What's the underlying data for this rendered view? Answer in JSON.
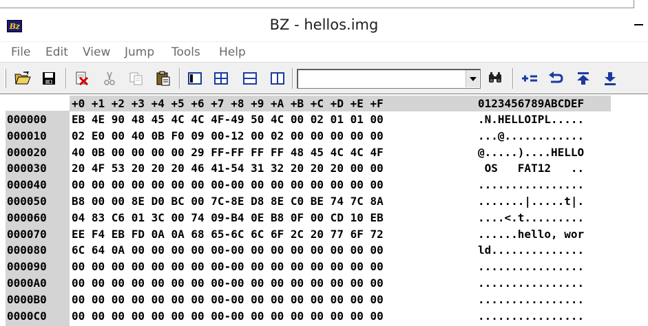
{
  "window": {
    "title": "BZ - hellos.img",
    "app_icon_text": "Bz"
  },
  "menu": [
    "File",
    "Edit",
    "View",
    "Jump",
    "Tools",
    "Help"
  ],
  "toolbar": {
    "search_value": "",
    "icons": [
      "open-icon",
      "save-icon",
      "delete-icon",
      "cut-icon",
      "copy-icon",
      "paste-icon",
      "view-mode-1-icon",
      "view-mode-2-icon",
      "split-horizontal-icon",
      "split-vertical-icon",
      "find-icon",
      "add-offset-icon",
      "back-icon",
      "jump-top-icon",
      "jump-bottom-icon"
    ]
  },
  "hexview": {
    "header_hex": "+0 +1 +2 +3 +4 +5 +6 +7 +8 +9 +A +B +C +D +E +F",
    "header_ascii": "0123456789ABCDEF",
    "rows": [
      {
        "addr": "000000",
        "hex": "EB 4E 90 48 45 4C 4C 4F-49 50 4C 00 02 01 01 00",
        "ascii": ".N.HELLOIPL....."
      },
      {
        "addr": "000010",
        "hex": "02 E0 00 40 0B F0 09 00-12 00 02 00 00 00 00 00",
        "ascii": "...@............"
      },
      {
        "addr": "000020",
        "hex": "40 0B 00 00 00 00 29 FF-FF FF FF 48 45 4C 4C 4F",
        "ascii": "@.....)....HELLO"
      },
      {
        "addr": "000030",
        "hex": "20 4F 53 20 20 20 46 41-54 31 32 20 20 20 00 00",
        "ascii": " OS   FAT12   .."
      },
      {
        "addr": "000040",
        "hex": "00 00 00 00 00 00 00 00-00 00 00 00 00 00 00 00",
        "ascii": "................"
      },
      {
        "addr": "000050",
        "hex": "B8 00 00 8E D0 BC 00 7C-8E D8 8E C0 BE 74 7C 8A",
        "ascii": ".......|.....t|."
      },
      {
        "addr": "000060",
        "hex": "04 83 C6 01 3C 00 74 09-B4 0E B8 0F 00 CD 10 EB",
        "ascii": "....<.t........."
      },
      {
        "addr": "000070",
        "hex": "EE F4 EB FD 0A 0A 68 65-6C 6C 6F 2C 20 77 6F 72",
        "ascii": "......hello, wor"
      },
      {
        "addr": "000080",
        "hex": "6C 64 0A 00 00 00 00 00-00 00 00 00 00 00 00 00",
        "ascii": "ld.............."
      },
      {
        "addr": "000090",
        "hex": "00 00 00 00 00 00 00 00-00 00 00 00 00 00 00 00",
        "ascii": "................"
      },
      {
        "addr": "0000A0",
        "hex": "00 00 00 00 00 00 00 00-00 00 00 00 00 00 00 00",
        "ascii": "................"
      },
      {
        "addr": "0000B0",
        "hex": "00 00 00 00 00 00 00 00-00 00 00 00 00 00 00 00",
        "ascii": "................"
      },
      {
        "addr": "0000C0",
        "hex": "00 00 00 00 00 00 00 00-00 00 00 00 00 00 00 00",
        "ascii": "................"
      }
    ]
  }
}
